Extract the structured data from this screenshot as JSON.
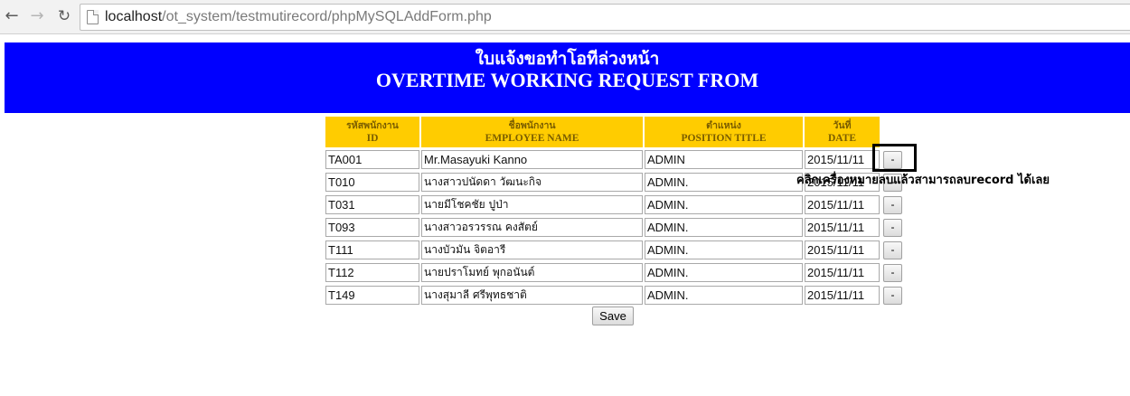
{
  "browser": {
    "url_host": "localhost",
    "url_path": "/ot_system/testmutirecord/phpMySQLAddForm.php"
  },
  "banner": {
    "title_thai": "ใบแจ้งขอทำโอทีล่วงหน้า",
    "title_en": "OVERTIME WORKING REQUEST FROM"
  },
  "table": {
    "headers": [
      {
        "thai": "รหัสพนักงาน",
        "en": "ID"
      },
      {
        "thai": "ชื่อพนักงาน",
        "en": "EMPLOYEE NAME"
      },
      {
        "thai": "ตำแหน่ง",
        "en": "POSITION TITLE"
      },
      {
        "thai": "วันที่",
        "en": "DATE"
      }
    ],
    "rows": [
      {
        "id": "TA001",
        "name": " Mr.Masayuki  Kanno",
        "title": "ADMIN",
        "date": "2015/11/11"
      },
      {
        "id": "T010",
        "name": " นางสาวปนัดดา  วัฒนะกิจ",
        "title": "ADMIN.",
        "date": "2015/11/11"
      },
      {
        "id": "T031",
        "name": " นายมีโชคชัย  ปูป่า",
        "title": "ADMIN.",
        "date": "2015/11/11"
      },
      {
        "id": "T093",
        "name": " นางสาวอรวรรณ  คงสัตย์",
        "title": "ADMIN.",
        "date": "2015/11/11"
      },
      {
        "id": "T111",
        "name": " นางบัวมัน  จิตอารี",
        "title": "ADMIN.",
        "date": "2015/11/11"
      },
      {
        "id": "T112",
        "name": " นายปราโมทย์  พุกอนันต์",
        "title": "ADMIN.",
        "date": "2015/11/11"
      },
      {
        "id": "T149",
        "name": " นางสุมาลี  ศรีพุทธชาติ",
        "title": "ADMIN.",
        "date": "2015/11/11"
      }
    ],
    "delete_label": "-"
  },
  "save_label": "Save",
  "annotation": "คลิกเครื่องหมายลบแล้วสามารถลบrecord ได้เลย"
}
